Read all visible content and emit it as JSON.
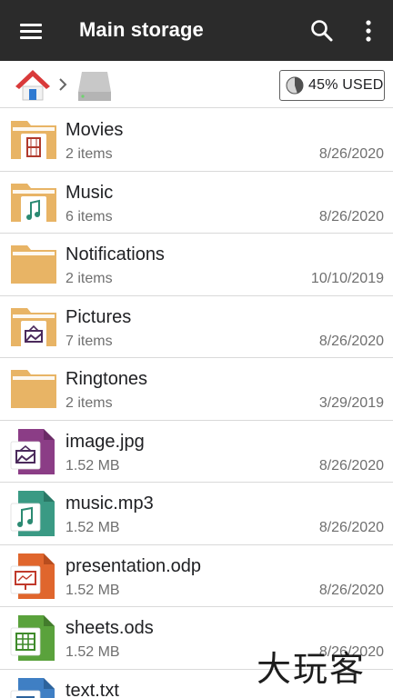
{
  "appbar": {
    "title": "Main storage"
  },
  "breadcrumb": {
    "storage_used": "45% USED",
    "storage_used_fraction": 0.45
  },
  "items": [
    {
      "name": "Movies",
      "sub": "2 items",
      "date": "8/26/2020",
      "icon": "folder-video-icon"
    },
    {
      "name": "Music",
      "sub": "6 items",
      "date": "8/26/2020",
      "icon": "folder-music-icon"
    },
    {
      "name": "Notifications",
      "sub": "2 items",
      "date": "10/10/2019",
      "icon": "folder-icon"
    },
    {
      "name": "Pictures",
      "sub": "7 items",
      "date": "8/26/2020",
      "icon": "folder-image-icon"
    },
    {
      "name": "Ringtones",
      "sub": "2 items",
      "date": "3/29/2019",
      "icon": "folder-icon"
    },
    {
      "name": "image.jpg",
      "sub": "1.52 MB",
      "date": "8/26/2020",
      "icon": "image-file-icon"
    },
    {
      "name": "music.mp3",
      "sub": "1.52 MB",
      "date": "8/26/2020",
      "icon": "audio-file-icon"
    },
    {
      "name": "presentation.odp",
      "sub": "1.52 MB",
      "date": "8/26/2020",
      "icon": "presentation-file-icon"
    },
    {
      "name": "sheets.ods",
      "sub": "1.52 MB",
      "date": "8/26/2020",
      "icon": "spreadsheet-file-icon"
    },
    {
      "name": "text.txt",
      "sub": "",
      "date": "",
      "icon": "text-file-icon"
    }
  ],
  "colors": {
    "appbar": "#2b2b2b",
    "folder": "#e8b465",
    "image_file": "#8b3d86",
    "audio_file": "#3a9a84",
    "presentation_file": "#e0662d",
    "spreadsheet_file": "#5aa23c",
    "text_file": "#3f7fc4"
  },
  "watermark": "大玩客"
}
